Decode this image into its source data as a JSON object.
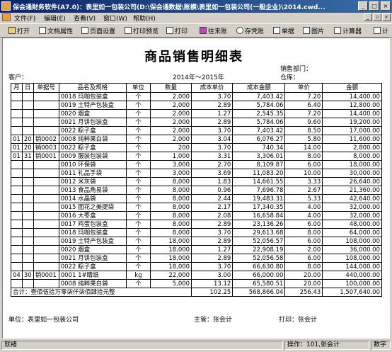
{
  "window": {
    "title": "保会通财务软件(A7.0)：表里如一包装公司(D:\\保会通数据\\账模\\表里如一包装公司(一般企业)\\2014.cwd..."
  },
  "menu": [
    "文件(F)",
    "编辑(E)",
    "查看(V)",
    "窗口(W)",
    "帮助(H)"
  ],
  "toolbar": [
    "打开",
    "文档属性",
    "页面设置",
    "打印预览",
    "打印",
    "往来账",
    "存凭账",
    "单据",
    "图片",
    "计算器",
    "计"
  ],
  "report": {
    "title": "商品销售明细表",
    "dept_label": "销售部门：",
    "customer_label": "客户：",
    "period": "2014年～2015年",
    "warehouse_label": "仓库：",
    "headers": [
      "月",
      "日",
      "单据号",
      "品名及规格",
      "单位",
      "数量",
      "成本单价",
      "成本金额",
      "单价",
      "金额"
    ],
    "rows": [
      [
        "",
        "",
        "",
        "0018 玛咖包装盒",
        "个",
        "2,000",
        "3.70",
        "7,403.42",
        "7.20",
        "14,400.00"
      ],
      [
        "",
        "",
        "",
        "0019 土特产包装盒",
        "个",
        "2,000",
        "2.89",
        "5,784.06",
        "6.40",
        "12,800.00"
      ],
      [
        "",
        "",
        "",
        "0020 烟盒",
        "个",
        "2,000",
        "1.27",
        "2,545.35",
        "7.20",
        "14,400.00"
      ],
      [
        "",
        "",
        "",
        "0021 月饼包装盒",
        "个",
        "2,000",
        "2.89",
        "5,784.06",
        "9.60",
        "19,200.00"
      ],
      [
        "",
        "",
        "",
        "0022 粽子盒",
        "个",
        "2,000",
        "3.70",
        "7,403.42",
        "8.50",
        "17,000.00"
      ],
      [
        "01",
        "20",
        "销0002",
        "0008 纯粹果白袋",
        "个",
        "2,000",
        "3.04",
        "6,076.27",
        "5.80",
        "11,600.00"
      ],
      [
        "01",
        "20",
        "销0003",
        "0022 粽子盒",
        "个",
        "200",
        "3.70",
        "740.34",
        "14.00",
        "2,800.00"
      ],
      [
        "01",
        "31",
        "销0001",
        "0009 服装包装袋",
        "个",
        "1,000",
        "3.31",
        "3,306.01",
        "8.00",
        "8,000.00"
      ],
      [
        "",
        "",
        "",
        "0010 环保袋",
        "个",
        "3,000",
        "2.70",
        "8,109.87",
        "6.00",
        "18,000.00"
      ],
      [
        "",
        "",
        "",
        "0011 礼品手袋",
        "个",
        "3,000",
        "3.69",
        "11,083.20",
        "10.00",
        "30,000.00"
      ],
      [
        "",
        "",
        "",
        "0012 米灰袋",
        "个",
        "8,000",
        "1.83",
        "14,661.55",
        "3.33",
        "26,640.00"
      ],
      [
        "",
        "",
        "",
        "0013 食品角易袋",
        "个",
        "8,000",
        "0.96",
        "7,696.78",
        "2.67",
        "21,360.00"
      ],
      [
        "",
        "",
        "",
        "0014 水晶袋",
        "个",
        "8,000",
        "2.44",
        "19,483.31",
        "5.33",
        "42,640.00"
      ],
      [
        "",
        "",
        "",
        "0015 团花之美提袋",
        "个",
        "8,000",
        "2.17",
        "17,340.35",
        "4.00",
        "32,000.00"
      ],
      [
        "",
        "",
        "",
        "0016 大枣盒",
        "个",
        "8,000",
        "2.08",
        "16,658.84",
        "4.00",
        "32,000.00"
      ],
      [
        "",
        "",
        "",
        "0017 鸡蛋包装盒",
        "个",
        "8,000",
        "2.89",
        "23,136.26",
        "6.00",
        "48,000.00"
      ],
      [
        "",
        "",
        "",
        "0018 玛咖包装盒",
        "个",
        "8,000",
        "3.70",
        "29,613.68",
        "8.00",
        "64,000.00"
      ],
      [
        "",
        "",
        "",
        "0019 土特产包装盒",
        "个",
        "18,000",
        "2.89",
        "52,056.57",
        "6.00",
        "108,000.00"
      ],
      [
        "",
        "",
        "",
        "0020 烟盒",
        "个",
        "18,000",
        "1.27",
        "22,908.19",
        "2.00",
        "36,000.00"
      ],
      [
        "",
        "",
        "",
        "0021 月饼包装盒",
        "个",
        "18,000",
        "2.89",
        "52,056.58",
        "6.00",
        "108,000.00"
      ],
      [
        "",
        "",
        "",
        "0022 粽子盒",
        "个",
        "18,000",
        "3.70",
        "66,630.80",
        "8.00",
        "144,000.00"
      ],
      [
        "04",
        "30",
        "销0001",
        "0001 1#睛纸",
        "kg",
        "22,000",
        "3.00",
        "66,000.00",
        "20.00",
        "440,000.00"
      ],
      [
        "",
        "",
        "",
        "0008 纯粹果白袋",
        "个",
        "5,000",
        "13.12",
        "65,580.51",
        "20.00",
        "100,000.00"
      ]
    ],
    "total_label": "合计：壹佰伍拾万零柒仟柒佰肆拾元整",
    "total": {
      "cost_price": "102.25",
      "cost_amount": "568,866.04",
      "price": "256.43",
      "amount": "1,507,640.00"
    },
    "unit_label": "单位：表里如一包装公司",
    "manager_label": "主管：张会计",
    "printer_label": "打印：张会计"
  },
  "status": {
    "left": "就绪",
    "operator": "操作：101,张会计",
    "mode": "数字"
  }
}
